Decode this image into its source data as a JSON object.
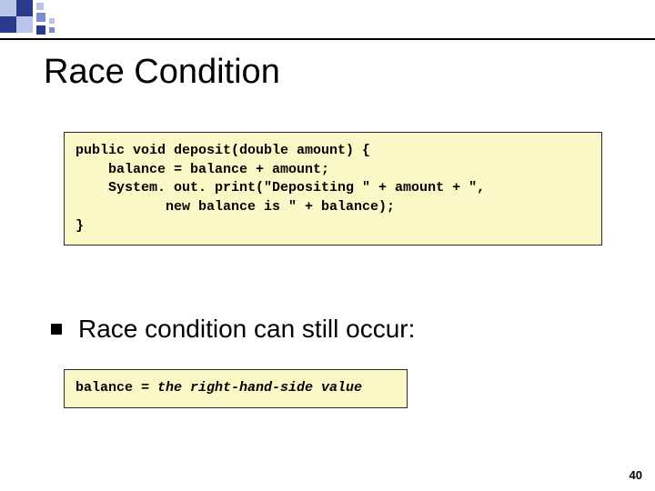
{
  "title": "Race Condition",
  "code_main": "public void deposit(double amount) {\n    balance = balance + amount;\n    System. out. print(\"Depositing \" + amount + \",\n           new balance is \" + balance);\n}",
  "bullet_text": "Race condition can still occur:",
  "code_small_prefix": "balance = ",
  "code_small_italic": "the right-hand-side value",
  "page_number": "40"
}
